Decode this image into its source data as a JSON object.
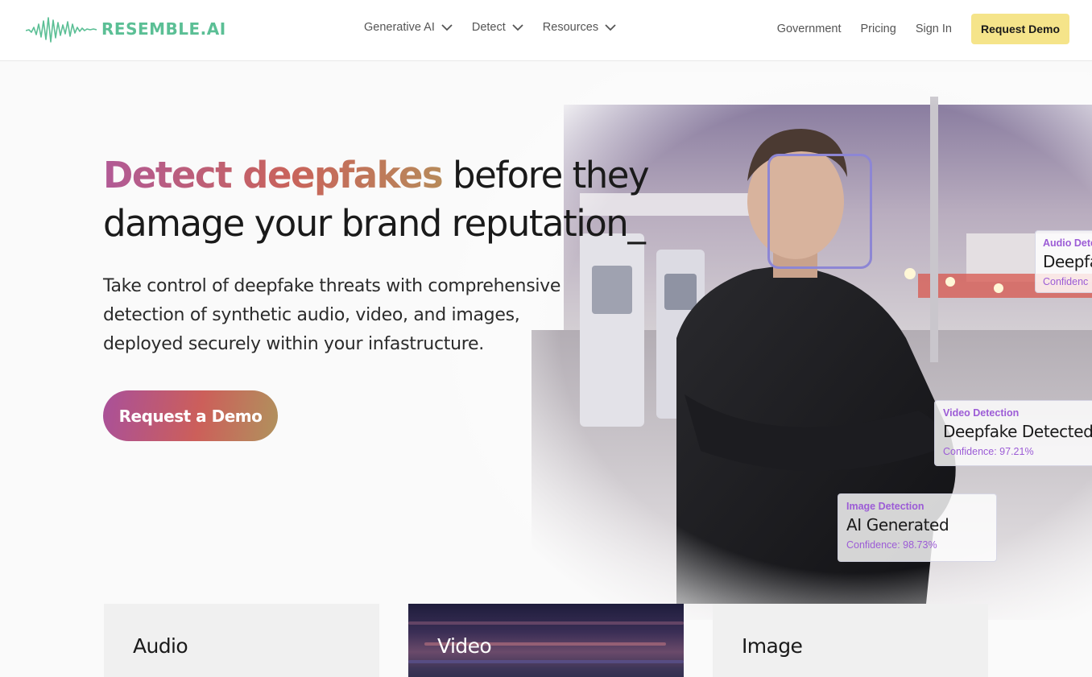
{
  "nav": {
    "logo_text": "RESEMBLE.AI",
    "menu": [
      {
        "label": "Generative AI"
      },
      {
        "label": "Detect"
      },
      {
        "label": "Resources"
      }
    ],
    "links": [
      {
        "label": "Government"
      },
      {
        "label": "Pricing"
      },
      {
        "label": "Sign In"
      }
    ],
    "cta_label": "Request Demo"
  },
  "hero": {
    "headline_highlight": "Detect deepfakes",
    "headline_rest_line1": " before they",
    "headline_line2": "damage your brand reputation_",
    "subtext": "Take control of deepfake threats with comprehensive detection of synthetic audio, video, and images, deployed securely within your infastructure.",
    "cta_label": "Request a Demo"
  },
  "detections": {
    "audio": {
      "label": "Audio Dete",
      "title": "Deepfa",
      "confidence": "Confidenc"
    },
    "video": {
      "label": "Video Detection",
      "title": "Deepfake Detected",
      "confidence": "Confidence: 97.21%"
    },
    "image": {
      "label": "Image Detection",
      "title": "AI Generated",
      "confidence": "Confidence: 98.73%"
    }
  },
  "bottom_cards": [
    {
      "title": "Audio"
    },
    {
      "title": "Video"
    },
    {
      "title": "Image"
    }
  ],
  "colors": {
    "brand_green": "#5bbf95",
    "demo_yellow": "#f5e48a",
    "accent_purple": "#9c5cd6",
    "gradient_start": "#b15a96",
    "gradient_end": "#b78a5a"
  }
}
